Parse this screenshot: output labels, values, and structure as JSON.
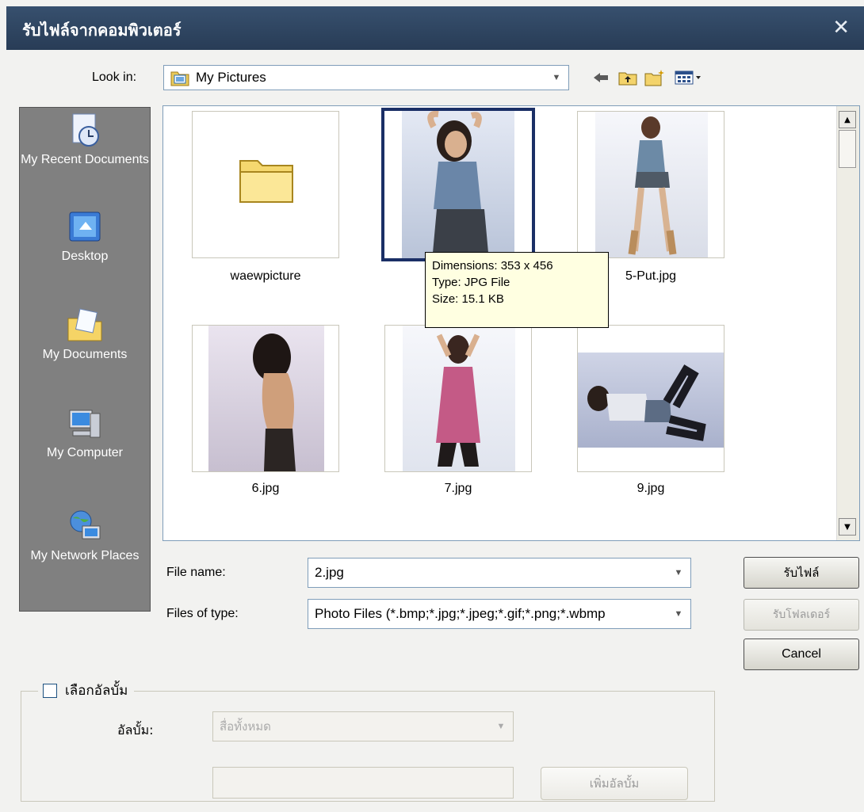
{
  "dialog": {
    "title": "รับไฟล์จากคอมพิวเตอร์",
    "close_symbol": "✕"
  },
  "lookin": {
    "label": "Look in:",
    "value": "My Pictures",
    "icon": "my-pictures-folder-icon"
  },
  "toolbar": {
    "back_icon": "back-arrow-icon",
    "up_icon": "up-folder-icon",
    "new_folder_icon": "new-folder-icon",
    "views_icon": "views-menu-icon"
  },
  "places": [
    {
      "label": "My Recent Documents",
      "icon": "recent-documents-icon"
    },
    {
      "label": "Desktop",
      "icon": "desktop-icon"
    },
    {
      "label": "My Documents",
      "icon": "my-documents-icon"
    },
    {
      "label": "My Computer",
      "icon": "my-computer-icon"
    },
    {
      "label": "My Network Places",
      "icon": "network-places-icon"
    }
  ],
  "files": [
    {
      "name": "waewpicture",
      "kind": "folder"
    },
    {
      "name": "",
      "kind": "photo",
      "selected": true
    },
    {
      "name": "5-Put.jpg",
      "kind": "photo"
    },
    {
      "name": "6.jpg",
      "kind": "photo"
    },
    {
      "name": "7.jpg",
      "kind": "photo"
    },
    {
      "name": "9.jpg",
      "kind": "photo"
    }
  ],
  "tooltip": {
    "dimensions": "Dimensions: 353 x 456",
    "type": "Type: JPG File",
    "size": "Size: 15.1 KB"
  },
  "filename": {
    "label": "File name:",
    "value": "2.jpg"
  },
  "filetype": {
    "label": "Files of type:",
    "value": "Photo Files (*.bmp;*.jpg;*.jpeg;*.gif;*.png;*.wbmp"
  },
  "buttons": {
    "open": "รับไฟล์",
    "open_folder": "รับโฟลเดอร์",
    "cancel": "Cancel"
  },
  "album": {
    "checkbox_label": "เลือกอัลบั้ม",
    "checked": false,
    "album_label": "อัลบั้ม:",
    "album_value": "สื่อทั้งหมด",
    "new_album_value": "",
    "add_album_button": "เพิ่มอัลบั้ม"
  },
  "colors": {
    "titlebar": "#2e4562",
    "places_bg": "#808080",
    "selection_border": "#1a2f66",
    "tooltip_bg": "#ffffe1"
  }
}
